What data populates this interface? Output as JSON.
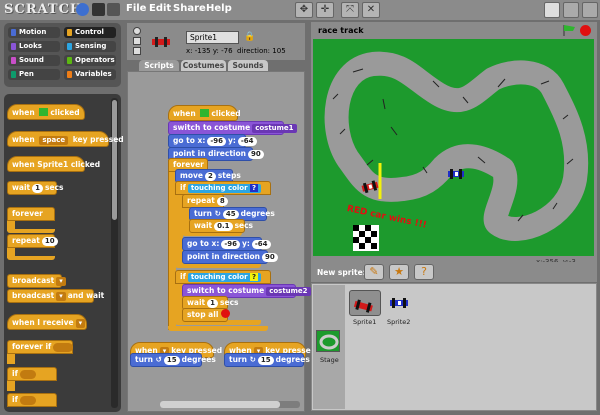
{
  "app": {
    "logo": "SCRATCH",
    "menu": [
      "File",
      "Edit",
      "Share",
      "Help"
    ]
  },
  "categories": [
    {
      "label": "Motion",
      "color": "#4a6cd4"
    },
    {
      "label": "Control",
      "color": "#e6a422"
    },
    {
      "label": "Looks",
      "color": "#8a55d7"
    },
    {
      "label": "Sensing",
      "color": "#2ca5e2"
    },
    {
      "label": "Sound",
      "color": "#c94fc9"
    },
    {
      "label": "Operators",
      "color": "#5cb712"
    },
    {
      "label": "Pen",
      "color": "#0e9a6c"
    },
    {
      "label": "Variables",
      "color": "#ee7d16"
    }
  ],
  "palette": {
    "when_clicked": "clicked",
    "when_key_pressed": {
      "key": "space",
      "suffix": "key pressed"
    },
    "when_sprite_clicked": "when Sprite1 clicked",
    "wait": {
      "pre": "wait",
      "value": "1",
      "post": "secs"
    },
    "forever": "forever",
    "repeat": {
      "pre": "repeat",
      "value": "10"
    },
    "broadcast": "broadcast",
    "broadcast_wait": {
      "pre": "broadcast",
      "post": "and wait"
    },
    "when_receive": "when I receive",
    "forever_if": "forever if",
    "if": "if",
    "when": "when"
  },
  "sprite": {
    "name": "Sprite1",
    "x_label": "x:",
    "x": "-135",
    "y_label": "y:",
    "y": "-76",
    "direction_label": "direction:",
    "direction": "105"
  },
  "tabs": [
    "Scripts",
    "Costumes",
    "Sounds"
  ],
  "script": {
    "when_clicked": "clicked",
    "switch_costume": {
      "pre": "switch to costume",
      "value": "costume1"
    },
    "goto": {
      "pre": "go to x:",
      "x": "-96",
      "mid": "y:",
      "y": "-64"
    },
    "point_dir": {
      "pre": "point in direction",
      "value": "90"
    },
    "forever": "forever",
    "move": {
      "pre": "move",
      "value": "2",
      "post": "steps"
    },
    "if_touching": {
      "pre": "if",
      "label": "touching color",
      "q": "?"
    },
    "repeat": {
      "pre": "repeat",
      "value": "8"
    },
    "turn": {
      "pre": "turn",
      "value": "45",
      "post": "degrees"
    },
    "wait": {
      "pre": "wait",
      "value": "0.1",
      "post": "secs"
    },
    "goto2": {
      "pre": "go to x:",
      "x": "-96",
      "mid": "y:",
      "y": "-64"
    },
    "point_dir2": {
      "pre": "point in direction",
      "value": "90"
    },
    "if_touching2": {
      "pre": "if",
      "label": "touching color",
      "q": "?"
    },
    "switch_costume2": {
      "pre": "switch to costume",
      "value": "costume2"
    },
    "wait2": {
      "pre": "wait",
      "value": "1",
      "post": "secs"
    },
    "stop_all": "stop all",
    "when_key1": {
      "pre": "when",
      "post": "key pressed"
    },
    "turn_left": {
      "pre": "turn",
      "value": "15",
      "post": "degrees"
    },
    "when_key2": {
      "pre": "when",
      "post": "key pressed"
    },
    "turn_right": {
      "pre": "turn",
      "value": "15",
      "post": "degrees"
    }
  },
  "stage": {
    "title": "race track",
    "win_text": "RED car wins !!!",
    "mouse_x_label": "x:",
    "mouse_x": "-356",
    "mouse_y_label": "y:",
    "mouse_y": "-3"
  },
  "new_sprite_label": "New sprite:",
  "sprites": [
    {
      "name": "Sprite1"
    },
    {
      "name": "Sprite2"
    }
  ],
  "stage_thumb_label": "Stage",
  "colors": {
    "grass": "#1d9a2d",
    "track": "#9a9a9a",
    "red_car": "#d21a1a",
    "blue_car": "#1f2fc8",
    "finish_line": "#f2f20a",
    "control": "#e6a422",
    "motion": "#4a6cd4",
    "looks": "#8a55d7",
    "sensing": "#2ca5e2"
  }
}
